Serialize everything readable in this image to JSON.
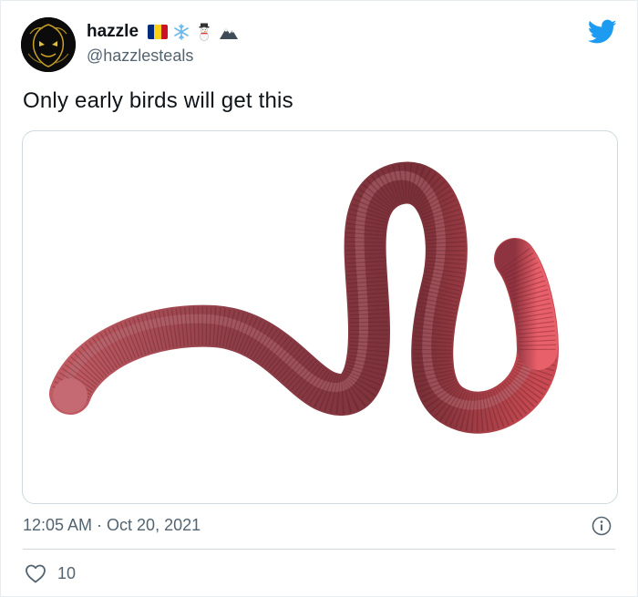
{
  "author": {
    "display_name": "hazzle",
    "handle": "@hazzlesteals",
    "name_emoji": {
      "flag_colors": [
        "#002B7F",
        "#FCD116",
        "#CE1126"
      ],
      "snowflake": "❄",
      "snowman": "⛄",
      "mountain": "⛰"
    }
  },
  "tweet": {
    "text": "Only early birds will get this",
    "timestamp": "12:05 AM · Oct 20, 2021",
    "like_count": "10"
  },
  "colors": {
    "brand": "#1d9bf0",
    "text": "#0f1419",
    "muted": "#536471",
    "border": "#cfd9de"
  },
  "icons": {
    "brand": "twitter-bird-icon",
    "info": "info-icon",
    "like": "heart-icon"
  }
}
